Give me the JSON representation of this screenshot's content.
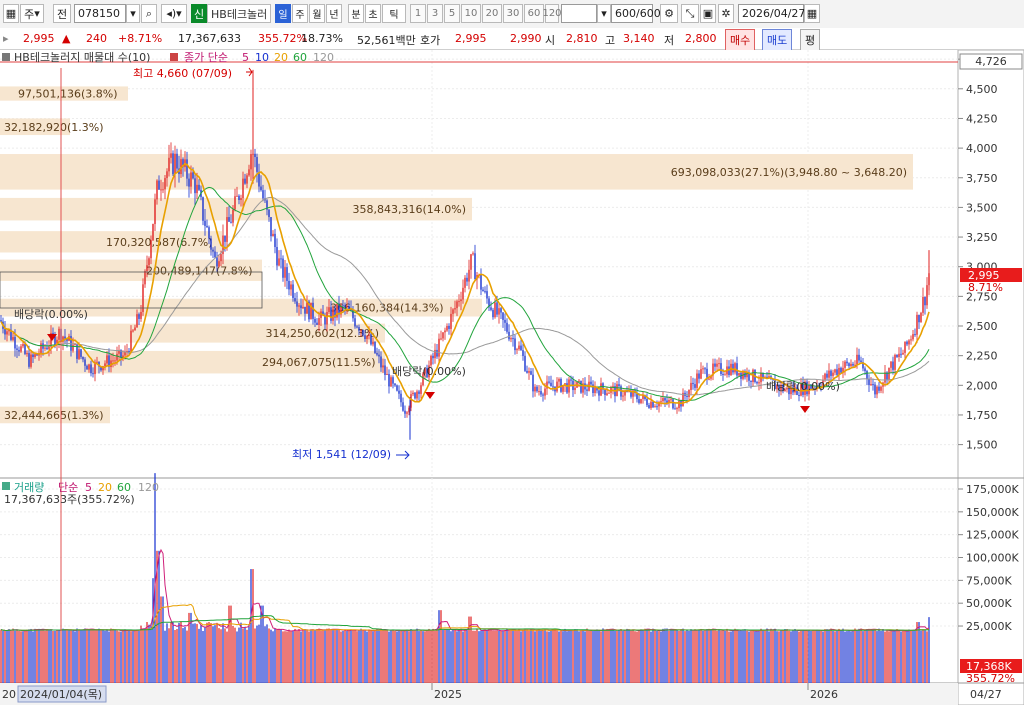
{
  "toolbar": {
    "period_main": "주",
    "view_label": "전",
    "code": "078150",
    "name_badge": "신",
    "stock_name": "HB테크놀러",
    "period_tabs": [
      "일",
      "주",
      "월",
      "년",
      "분",
      "초",
      "틱"
    ],
    "interval_tabs": [
      "1",
      "3",
      "5",
      "10",
      "20",
      "30",
      "60",
      "120"
    ],
    "count": "600/600",
    "date": "2026/04/27"
  },
  "quote": {
    "price": "2,995",
    "change": "240",
    "change_pct": "+8.71%",
    "volume": "17,367,633",
    "volume_pct": "355.72%",
    "turnover": "18.73%",
    "amount": "52,561백만",
    "bid_label": "호가",
    "ask": "2,995",
    "bid": "2,990",
    "open_label": "시",
    "open": "2,810",
    "high_label": "고",
    "high": "3,140",
    "low_label": "저",
    "low": "2,800",
    "buy_btn": "매수",
    "sell_btn": "매도",
    "eval_btn": "평"
  },
  "legend": {
    "main": "HB테크놀러지 매물대 수(10)",
    "ma_title": "종가 단순",
    "ma_periods": [
      "5",
      "10",
      "20",
      "60",
      "120"
    ],
    "vol_title": "거래량",
    "vol_ma_title": "단순",
    "vol_ma_periods": [
      "5",
      "20",
      "60",
      "120"
    ],
    "vol_value": "17,367,633주(355.72%)"
  },
  "annotations": {
    "high": "최고 4,660 (07/09)",
    "low": "최저 1,541 (12/09)",
    "dividend": "배당락(0.00%)",
    "top_value": "4,726",
    "price_tag": "2,995",
    "price_pct": "8.71%",
    "vol_tag": "17,368K",
    "vol_pct": "355.72%"
  },
  "volume_profile": [
    {
      "label": "97,501,136(3.8%)"
    },
    {
      "label": "32,182,920(1.3%)"
    },
    {
      "label": "693,098,033(27.1%)(3,948.80 ~ 3,648.20)"
    },
    {
      "label": "358,843,316(14.0%)"
    },
    {
      "label": "170,320,587(6.7%)"
    },
    {
      "label": "200,489,147(7.8%)"
    },
    {
      "label": "366,160,384(14.3%)"
    },
    {
      "label": "314,250,602(12.3%)"
    },
    {
      "label": "294,067,075(11.5%)"
    },
    {
      "label": "32,444,665(1.3%)"
    }
  ],
  "price_axis": [
    "4,750",
    "4,500",
    "4,250",
    "4,000",
    "3,750",
    "3,500",
    "3,250",
    "3,000",
    "2,750",
    "2,500",
    "2,250",
    "2,000",
    "1,750",
    "1,500"
  ],
  "volume_axis": [
    "175,000K",
    "150,000K",
    "125,000K",
    "100,000K",
    "75,000K",
    "50,000K",
    "25,000K"
  ],
  "time_axis": {
    "cursor_label": "2024/01/04(목)",
    "labels": [
      "2025",
      "2026"
    ],
    "end": "04/27",
    "left_stub": "20"
  },
  "colors": {
    "up": "#e02020",
    "down": "#1530d0",
    "ma5": "#e8a000",
    "ma20": "#21a43c",
    "ma120": "#9a9a9a",
    "profile": "#f7e6d0"
  }
}
